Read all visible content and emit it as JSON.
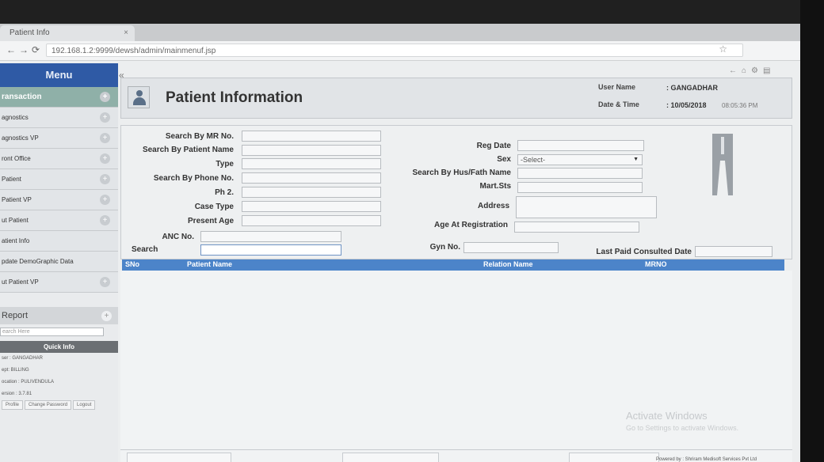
{
  "browser": {
    "tab_title": "Patient Info",
    "url": "192.168.1.2:9999/dewsh/admin/mainmenuf.jsp",
    "icons": [
      "back-icon",
      "forward-icon",
      "reload-icon",
      "star-icon"
    ]
  },
  "sidebar": {
    "menu_title": "Menu",
    "items": [
      {
        "label": "ransaction",
        "active": true
      },
      {
        "label": "agnostics",
        "active": false
      },
      {
        "label": "agnostics VP",
        "active": false
      },
      {
        "label": "ront Office",
        "active": false
      },
      {
        "label": "Patient",
        "active": false
      },
      {
        "label": "Patient VP",
        "active": false
      },
      {
        "label": "ut Patient",
        "active": false
      },
      {
        "label": "atient Info",
        "active": false
      },
      {
        "label": "pdate DemoGraphic Data",
        "active": false
      },
      {
        "label": "ut Patient VP",
        "active": false
      }
    ],
    "report_label": "Report",
    "search_placeholder": "earch Here",
    "quick_info": {
      "title": "Quick Info",
      "user": "ser : GANGADHAR",
      "dept": "ept: BILLING",
      "location": "ocation : PULIVENDULA",
      "version": "ersion : 3.7.81",
      "buttons": [
        "Profile",
        "Change Password",
        "Logout"
      ]
    }
  },
  "header": {
    "title": "Patient Information",
    "user_name_label": "User Name",
    "user_name_value": ": GANGADHAR",
    "date_label": "Date & Time",
    "date_value": ": 10/05/2018",
    "time_value": "08:05:36 PM"
  },
  "form": {
    "search_mr_label": "Search By MR No.",
    "search_name_label": "Search By Patient Name",
    "type_label": "Type",
    "search_phone_label": "Search By Phone No.",
    "ph2_label": "Ph 2.",
    "case_type_label": "Case Type",
    "present_age_label": "Present Age",
    "anc_label": "ANC No.",
    "search_label": "Search",
    "reg_date_label": "Reg Date",
    "sex_label": "Sex",
    "sex_value": "-Select-",
    "hus_fath_label": "Search By Hus/Fath Name",
    "mart_label": "Mart.Sts",
    "address_label": "Address",
    "age_reg_label": "Age At Registration",
    "gyn_label": "Gyn No.",
    "last_paid_label": "Last Paid Consulted Date"
  },
  "grid": {
    "columns": [
      "SNo",
      "Patient Name",
      "Relation Name",
      "MRNO"
    ]
  },
  "watermark": {
    "line1": "Activate Windows",
    "line2": "Go to Settings to activate Windows."
  },
  "footer": {
    "powered": "Powered by : Shriram Medisoft Services Pvt Ltd"
  },
  "colors": {
    "menu_header": "#2f5aa5",
    "active_item": "#8fb0a8",
    "grid_header": "#4c84c9"
  }
}
